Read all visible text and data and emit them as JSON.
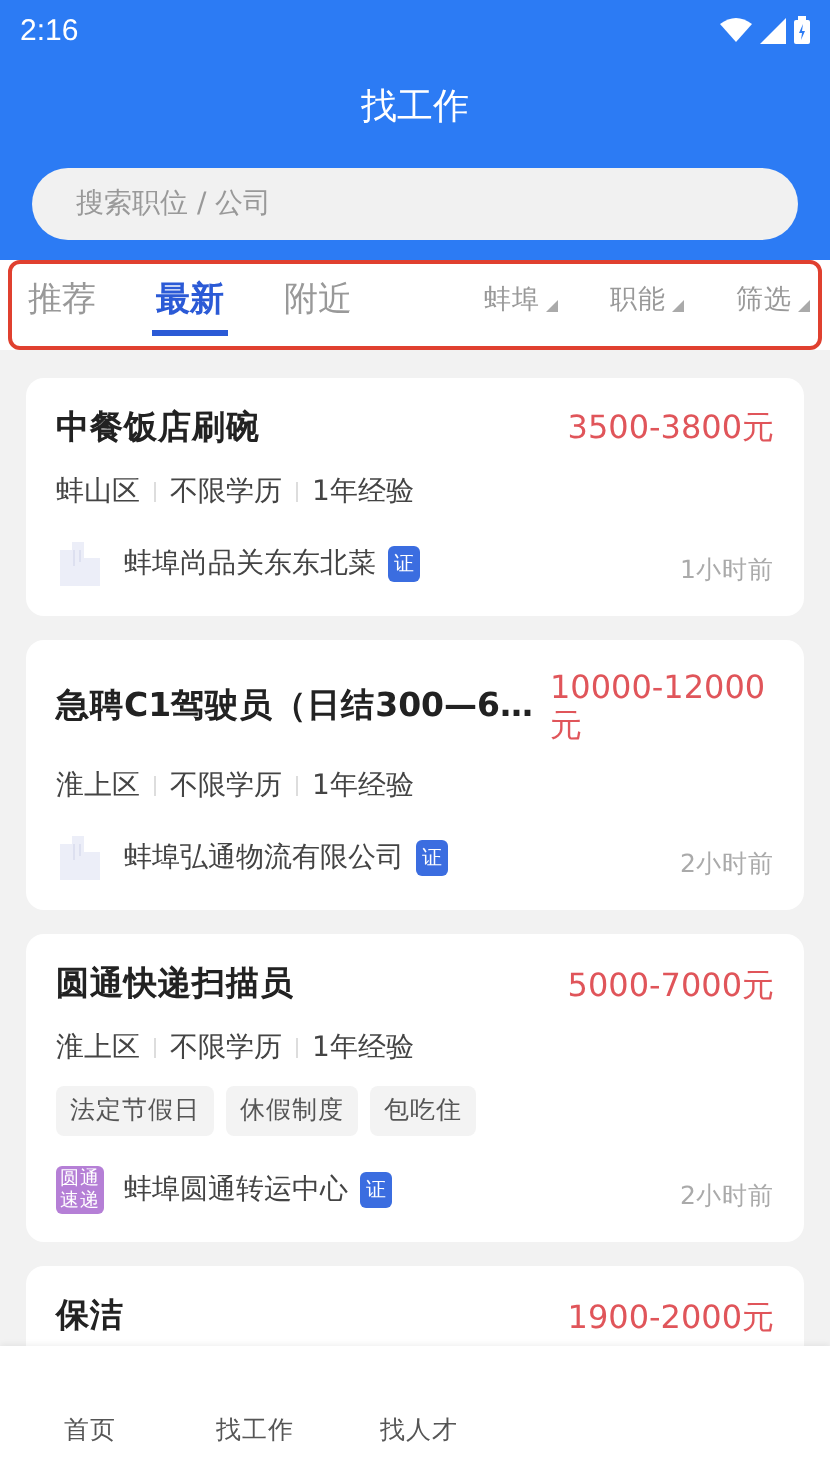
{
  "status_bar": {
    "time": "2:16"
  },
  "header": {
    "title": "找工作"
  },
  "search": {
    "placeholder": "搜索职位 / 公司"
  },
  "filter_bar": {
    "highlighted": true,
    "tabs": [
      {
        "label": "推荐",
        "selected": false
      },
      {
        "label": "最新",
        "selected": true
      },
      {
        "label": "附近",
        "selected": false
      }
    ],
    "dropdowns": [
      "蚌埠",
      "职能",
      "筛选"
    ]
  },
  "jobs": [
    {
      "title": "中餐饭店刷碗",
      "salary": "3500-3800元",
      "meta": [
        "蚌山区",
        "不限学历",
        "1年经验"
      ],
      "logo": {
        "kind": "building"
      },
      "company": "蚌埠尚品关东东北菜",
      "badge": "证",
      "time": "1小时前"
    },
    {
      "title": "急聘C1驾驶员（日结300—6…",
      "salary": "10000-12000元",
      "meta": [
        "淮上区",
        "不限学历",
        "1年经验"
      ],
      "logo": {
        "kind": "building"
      },
      "company": "蚌埠弘通物流有限公司",
      "badge": "证",
      "time": "2小时前"
    },
    {
      "title": "圆通快递扫描员",
      "salary": "5000-7000元",
      "meta": [
        "淮上区",
        "不限学历",
        "1年经验"
      ],
      "tags": [
        "法定节假日",
        "休假制度",
        "包吃住"
      ],
      "logo": {
        "kind": "text",
        "text": "圆通速递",
        "color": "#b57fd6"
      },
      "company": "蚌埠圆通转运中心",
      "badge": "证",
      "time": "2小时前"
    },
    {
      "title": "保洁",
      "salary": "1900-2000元"
    }
  ],
  "bottom_nav": [
    "首页",
    "找工作",
    "找人才"
  ]
}
